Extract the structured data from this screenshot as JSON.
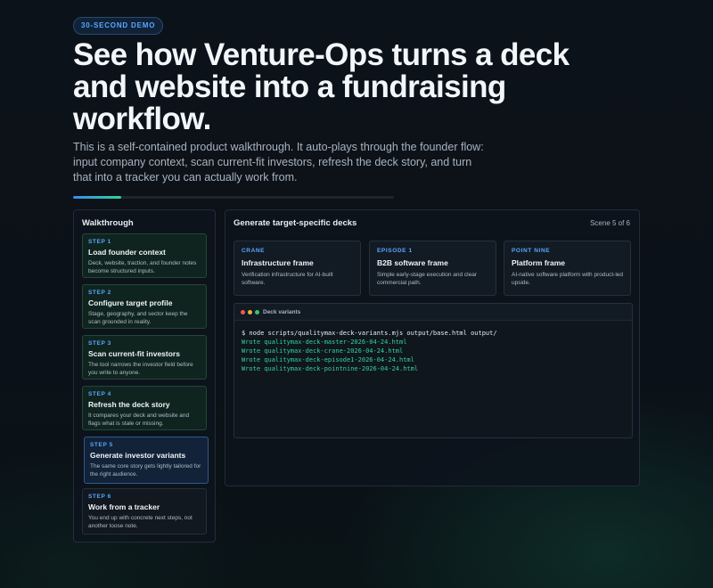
{
  "badge": "30-SECOND DEMO",
  "headline": "See how Venture-Ops turns a deck and website into a fundraising workflow.",
  "subtitle": "This is a self-contained product walkthrough. It auto-plays through the founder flow: input company context, scan current-fit investors, refresh the deck story, and turn that into a tracker you can actually work from.",
  "progress": 0.15,
  "walkthrough": {
    "title": "Walkthrough",
    "steps": [
      {
        "label": "STEP 1",
        "title": "Load founder context",
        "desc": "Deck, website, traction, and founder notes become structured inputs."
      },
      {
        "label": "STEP 2",
        "title": "Configure target profile",
        "desc": "Stage, geography, and sector keep the scan grounded in reality."
      },
      {
        "label": "STEP 3",
        "title": "Scan current-fit investors",
        "desc": "The tool narrows the investor field before you write to anyone."
      },
      {
        "label": "STEP 4",
        "title": "Refresh the deck story",
        "desc": "It compares your deck and website and flags what is stale or missing."
      },
      {
        "label": "STEP 5",
        "title": "Generate investor variants",
        "desc": "The same core story gets lightly tailored for the right audience."
      },
      {
        "label": "STEP 6",
        "title": "Work from a tracker",
        "desc": "You end up with concrete next steps, not another loose note."
      }
    ]
  },
  "main": {
    "title": "Generate target-specific decks",
    "scene": "Scene 5 of 6",
    "cards": [
      {
        "label": "CRANE",
        "title": "Infrastructure frame",
        "desc": "Verification infrastructure for AI-built software."
      },
      {
        "label": "EPISODE 1",
        "title": "B2B software frame",
        "desc": "Simple early-stage execution and clear commercial path."
      },
      {
        "label": "POINT NINE",
        "title": "Platform frame",
        "desc": "AI-native software platform with product-led upside."
      }
    ],
    "terminal": {
      "title": "Deck variants",
      "command": "$ node scripts/qualitymax-deck-variants.mjs output/base.html output/",
      "output": [
        "Wrote qualitymax-deck-master-2026-04-24.html",
        "Wrote qualitymax-deck-crane-2026-04-24.html",
        "Wrote qualitymax-deck-episode1-2026-04-24.html",
        "Wrote qualitymax-deck-pointnine-2026-04-24.html"
      ]
    }
  },
  "colors": {
    "accent": "#5aa6ff",
    "success": "#34d399",
    "dot_red": "#ef5b4f",
    "dot_yellow": "#e9b23c",
    "dot_green": "#3cc46d"
  }
}
